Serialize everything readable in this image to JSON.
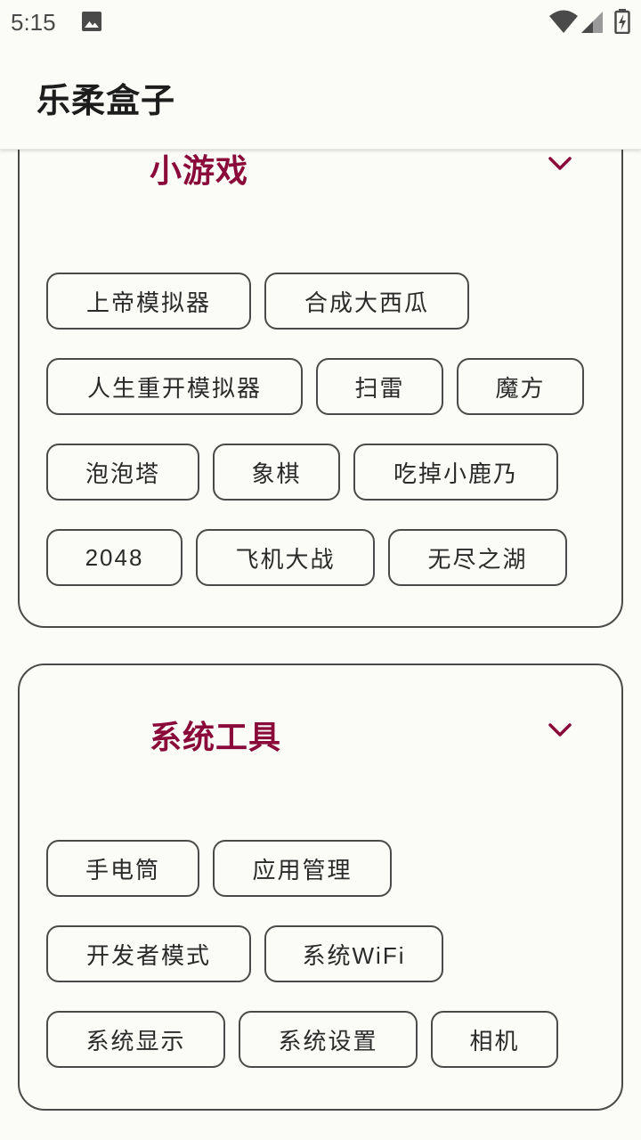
{
  "status_bar": {
    "time": "5:15",
    "icons": [
      "image-icon",
      "wifi-icon",
      "signal-icon",
      "battery-charging-icon"
    ]
  },
  "app_bar": {
    "title": "乐柔盒子"
  },
  "colors": {
    "background": "#fbfbf7",
    "section_title": "#8a0a3a",
    "border": "#4a4a4a",
    "text": "#2a2a2a"
  },
  "sections": [
    {
      "title": "小游戏",
      "expand_icon": "chevron-down-icon",
      "items": [
        "上帝模拟器",
        "合成大西瓜",
        "人生重开模拟器",
        "扫雷",
        "魔方",
        "泡泡塔",
        "象棋",
        "吃掉小鹿乃",
        "2048",
        "飞机大战",
        "无尽之湖"
      ]
    },
    {
      "title": "系统工具",
      "expand_icon": "chevron-down-icon",
      "items": [
        "手电筒",
        "应用管理",
        "开发者模式",
        "系统WiFi",
        "系统显示",
        "系统设置",
        "相机"
      ]
    }
  ]
}
